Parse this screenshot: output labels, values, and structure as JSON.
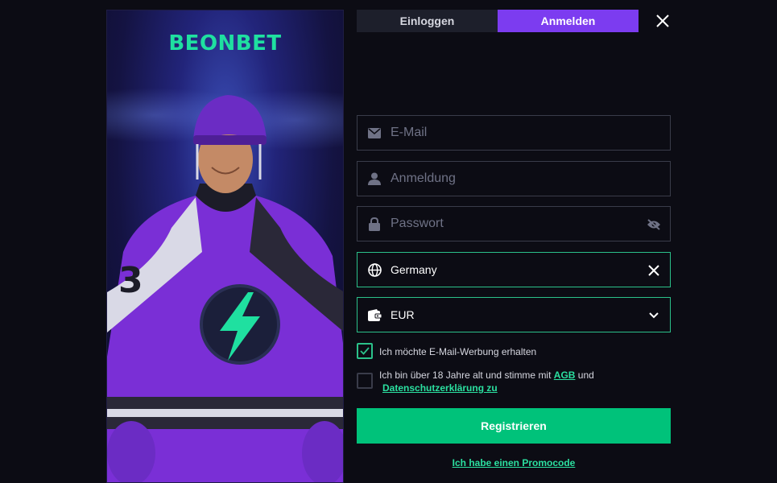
{
  "banner": {
    "logo_text": "BEONBET"
  },
  "tabs": {
    "login": "Einloggen",
    "register": "Anmelden"
  },
  "form": {
    "email_placeholder": "E-Mail",
    "login_placeholder": "Anmeldung",
    "password_placeholder": "Passwort",
    "country_value": "Germany",
    "currency_value": "EUR",
    "email_ads_label": "Ich möchte E-Mail-Werbung erhalten",
    "email_ads_checked": true,
    "age_prefix": "Ich bin über 18 Jahre alt und stimme mit ",
    "age_agb": "AGB",
    "age_mid": " und",
    "age_privacy": "Datenschutzerklärung zu",
    "age_checked": false,
    "register_button": "Registrieren",
    "promo_link": "Ich habe einen Promocode"
  },
  "colors": {
    "accent_purple": "#7c3cf0",
    "accent_green": "#00c27a",
    "background": "#0c0c14"
  },
  "icons": [
    "close-icon",
    "envelope-icon",
    "user-icon",
    "lock-icon",
    "eye-off-icon",
    "globe-icon",
    "clear-icon",
    "wallet-icon",
    "chevron-down-icon",
    "check-icon"
  ]
}
